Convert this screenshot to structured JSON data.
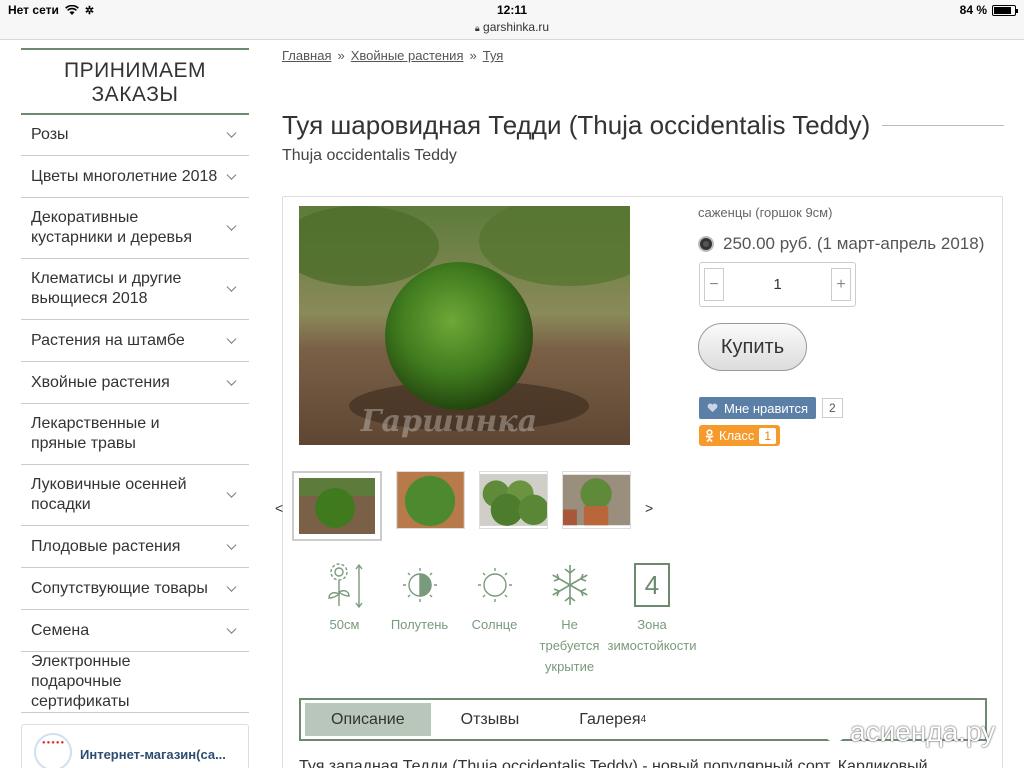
{
  "status_bar": {
    "carrier": "Нет сети",
    "time": "12:11",
    "url": "garshinka.ru",
    "battery": "84 %",
    "battery_level": 0.84
  },
  "sidebar": {
    "title": "ПРИНИМАЕМ ЗАКАЗЫ",
    "items": [
      {
        "label": "Розы",
        "has_submenu": true
      },
      {
        "label": "Цветы многолетние 2018",
        "has_submenu": true
      },
      {
        "label": "Декоративные кустарники и деревья",
        "has_submenu": true
      },
      {
        "label": "Клематисы и другие вьющиеся 2018",
        "has_submenu": true
      },
      {
        "label": "Растения на штамбе",
        "has_submenu": true
      },
      {
        "label": "Хвойные растения",
        "has_submenu": true
      },
      {
        "label": "Лекарственные и пряные травы",
        "has_submenu": false
      },
      {
        "label": "Луковичные осенней посадки",
        "has_submenu": true
      },
      {
        "label": "Плодовые растения",
        "has_submenu": true
      },
      {
        "label": "Сопутствующие товары",
        "has_submenu": true
      },
      {
        "label": "Семена",
        "has_submenu": true
      },
      {
        "label": "Электронные подарочные сертификаты",
        "has_submenu": false
      }
    ],
    "store": {
      "name": "Интернет-магазин(са...",
      "logo_text": "Гаршинка"
    }
  },
  "breadcrumb": [
    "Главная",
    "Хвойные растения",
    "Туя"
  ],
  "breadcrumb_separator": "»",
  "product": {
    "title": "Туя шаровидная Тедди (Thuja occidentalis Teddy)",
    "subtitle": "Thuja occidentalis Teddy",
    "photo_watermark": "Гаршинка",
    "variant_label": "саженцы (горшок 9см)",
    "price": "250.00 руб. (1 март-апрель 2018)",
    "quantity": "1",
    "qty_minus": "−",
    "qty_plus": "+",
    "buy_label": "Купить",
    "vk_like_label": "Мне нравится",
    "vk_like_count": "2",
    "ok_label": "Класс",
    "ok_count": "1",
    "thumb_prev": "<",
    "thumb_next": ">",
    "features": [
      {
        "icon": "height-flower-icon",
        "label": "50см"
      },
      {
        "icon": "half-shade-icon",
        "label": "Полутень"
      },
      {
        "icon": "sun-icon",
        "label": "Солнце"
      },
      {
        "icon": "snowflake-icon",
        "label": "Не требуется укрытие"
      },
      {
        "icon": "zone-box",
        "label": "Зона зимостойкости",
        "zone": "4"
      }
    ],
    "tabs": [
      {
        "label": "Описание",
        "active": true
      },
      {
        "label": "Отзывы",
        "active": false
      },
      {
        "label": "Галерея",
        "count": "4",
        "active": false
      }
    ],
    "description": "Туя западная Тедди (Thuja occidentalis Teddy) - новый популярный сорт. Карликовый"
  },
  "watermark": "асиенда.ру",
  "colors": {
    "accent": "#6b8a6e",
    "feature_text": "#7a9a7c",
    "vk": "#5b7fa6",
    "ok": "#f79a2c"
  }
}
